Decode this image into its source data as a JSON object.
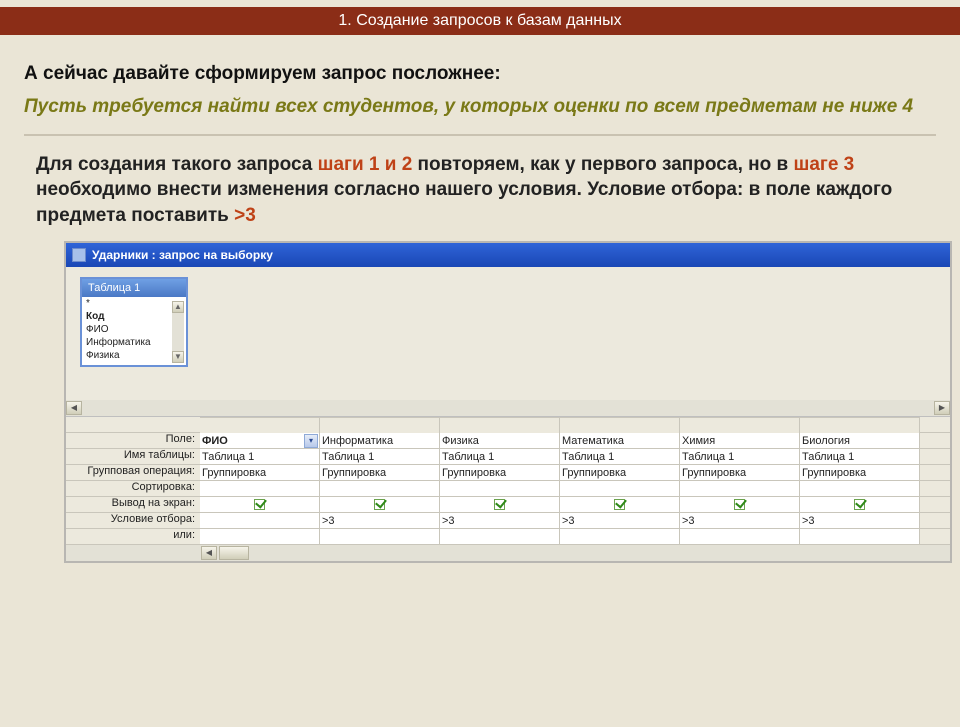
{
  "header": "1. Создание запросов к базам данных",
  "lead": "А сейчас давайте сформируем запрос посложнее:",
  "task": "Пусть требуется найти всех студентов, у которых оценки по всем предметам не ниже 4",
  "instr_pre": "Для создания такого запроса ",
  "instr_hl1": "шаги 1 и 2",
  "instr_mid1": " повторяем, как у первого запроса, но в ",
  "instr_hl2": "шаге 3",
  "instr_mid2": " необходимо внести изменения согласно нашего условия. Условие отбора: в поле каждого предмета поставить ",
  "instr_hl3": ">3",
  "win": {
    "title": "Ударники : запрос на выборку",
    "table_box": {
      "title": "Таблица 1",
      "rows": [
        "*",
        "Код",
        "ФИО",
        "Информатика",
        "Физика"
      ]
    }
  },
  "grid": {
    "row_labels": [
      "Поле:",
      "Имя таблицы:",
      "Групповая операция:",
      "Сортировка:",
      "Вывод на экран:",
      "Условие отбора:",
      "или:"
    ],
    "columns": [
      {
        "field": "ФИО",
        "table": "Таблица 1",
        "group": "Группировка",
        "sort": "",
        "show": true,
        "cond": "",
        "has_dd": true
      },
      {
        "field": "Информатика",
        "table": "Таблица 1",
        "group": "Группировка",
        "sort": "",
        "show": true,
        "cond": ">3"
      },
      {
        "field": "Физика",
        "table": "Таблица 1",
        "group": "Группировка",
        "sort": "",
        "show": true,
        "cond": ">3"
      },
      {
        "field": "Математика",
        "table": "Таблица 1",
        "group": "Группировка",
        "sort": "",
        "show": true,
        "cond": ">3"
      },
      {
        "field": "Химия",
        "table": "Таблица 1",
        "group": "Группировка",
        "sort": "",
        "show": true,
        "cond": ">3"
      },
      {
        "field": "Биология",
        "table": "Таблица 1",
        "group": "Группировка",
        "sort": "",
        "show": true,
        "cond": ">3"
      }
    ]
  }
}
